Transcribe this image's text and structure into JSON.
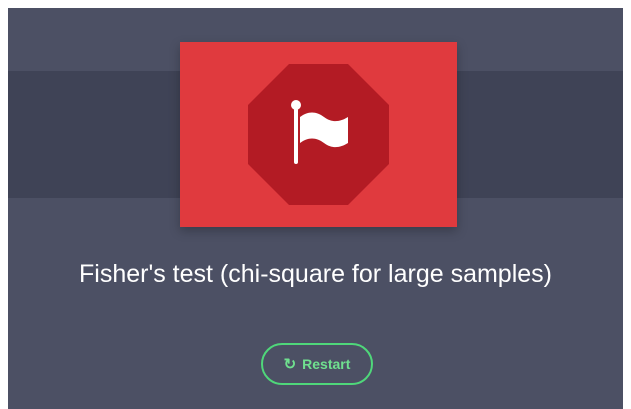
{
  "card": {
    "title": "Fisher's test (chi-square for large samples)",
    "icon": "flag-icon"
  },
  "actions": {
    "restart_label": "Restart",
    "restart_icon": "↻"
  },
  "colors": {
    "background": "#4c5064",
    "band": "#3f4356",
    "hero": "#e03a3e",
    "octagon": "#b31b24",
    "button_accent": "#4fd77a"
  }
}
